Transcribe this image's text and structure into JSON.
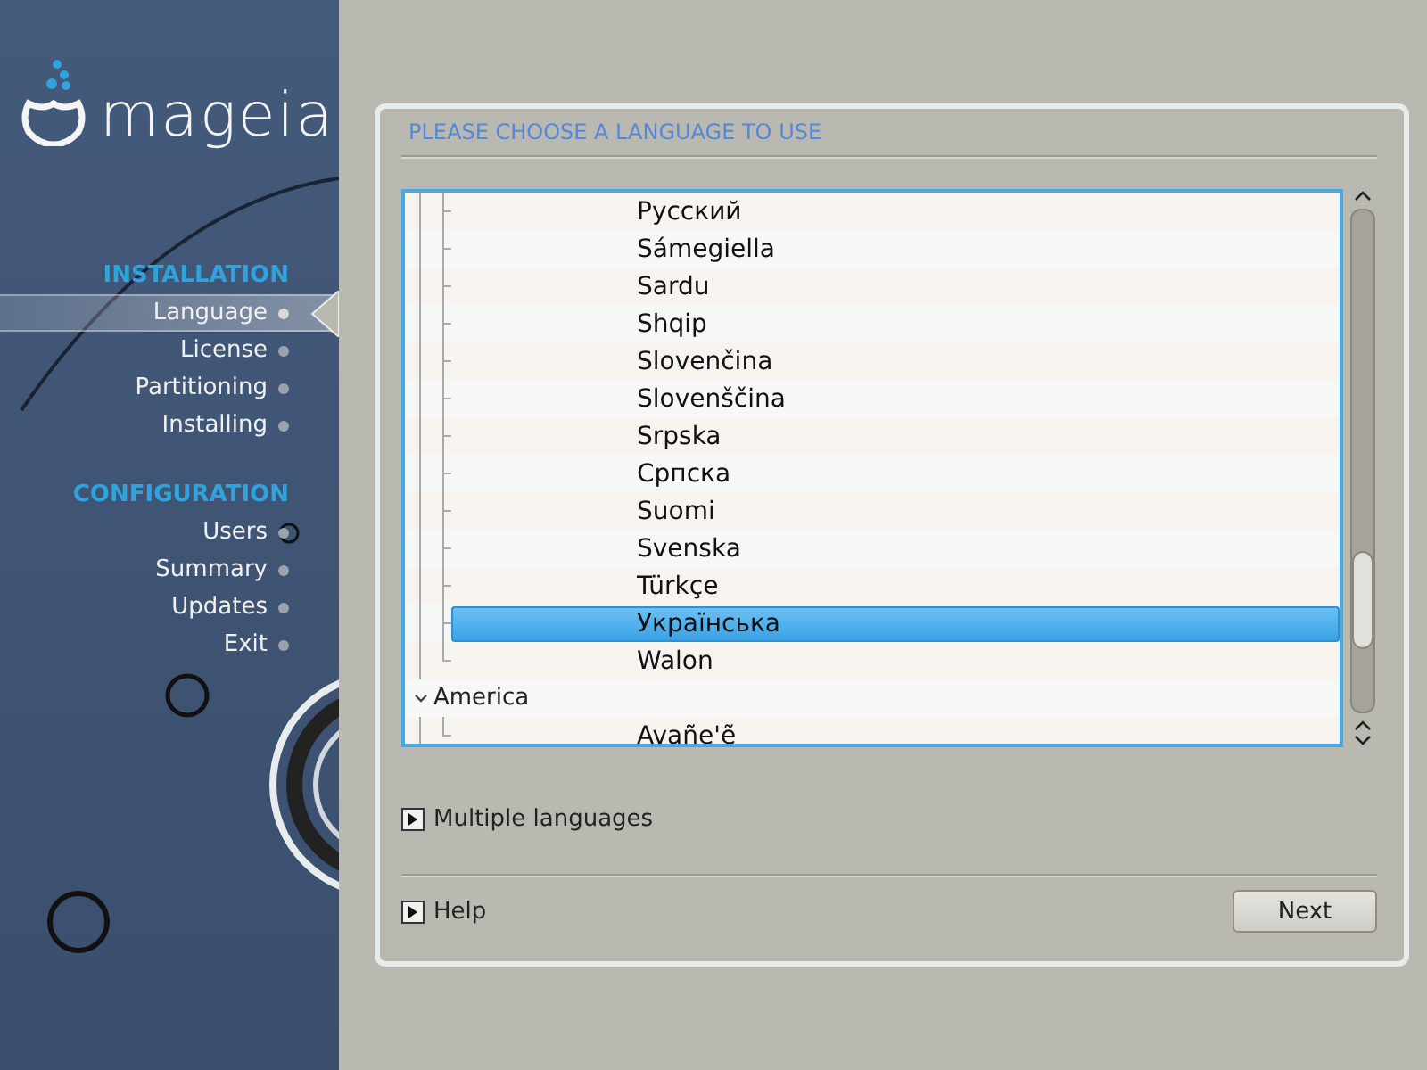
{
  "logo": {
    "name": "mageia"
  },
  "sidebar": {
    "sections": [
      {
        "title": "INSTALLATION",
        "items": [
          {
            "label": "Language",
            "selected": true
          },
          {
            "label": "License",
            "selected": false
          },
          {
            "label": "Partitioning",
            "selected": false
          },
          {
            "label": "Installing",
            "selected": false
          }
        ]
      },
      {
        "title": "CONFIGURATION",
        "items": [
          {
            "label": "Users",
            "selected": false
          },
          {
            "label": "Summary",
            "selected": false
          },
          {
            "label": "Updates",
            "selected": false
          },
          {
            "label": "Exit",
            "selected": false
          }
        ]
      }
    ]
  },
  "panel": {
    "title": "PLEASE CHOOSE A LANGUAGE TO USE",
    "tree": [
      {
        "kind": "item",
        "label": "Русский",
        "selected": false
      },
      {
        "kind": "item",
        "label": "Sámegiella",
        "selected": false
      },
      {
        "kind": "item",
        "label": "Sardu",
        "selected": false
      },
      {
        "kind": "item",
        "label": "Shqip",
        "selected": false
      },
      {
        "kind": "item",
        "label": "Slovenčina",
        "selected": false
      },
      {
        "kind": "item",
        "label": "Slovenščina",
        "selected": false
      },
      {
        "kind": "item",
        "label": "Srpska",
        "selected": false
      },
      {
        "kind": "item",
        "label": "Српска",
        "selected": false
      },
      {
        "kind": "item",
        "label": "Suomi",
        "selected": false
      },
      {
        "kind": "item",
        "label": "Svenska",
        "selected": false
      },
      {
        "kind": "item",
        "label": "Türkçe",
        "selected": false
      },
      {
        "kind": "item",
        "label": "Українська",
        "selected": true
      },
      {
        "kind": "item",
        "label": "Walon",
        "selected": false
      },
      {
        "kind": "group",
        "label": "America",
        "expanded": true,
        "children": [
          {
            "kind": "item",
            "label": "Avañe'ẽ",
            "selected": false
          }
        ]
      }
    ],
    "expanders": [
      {
        "label": "Multiple languages",
        "expanded": false
      }
    ],
    "help": {
      "label": "Help",
      "expanded": false
    },
    "buttons": [
      "Next"
    ]
  }
}
